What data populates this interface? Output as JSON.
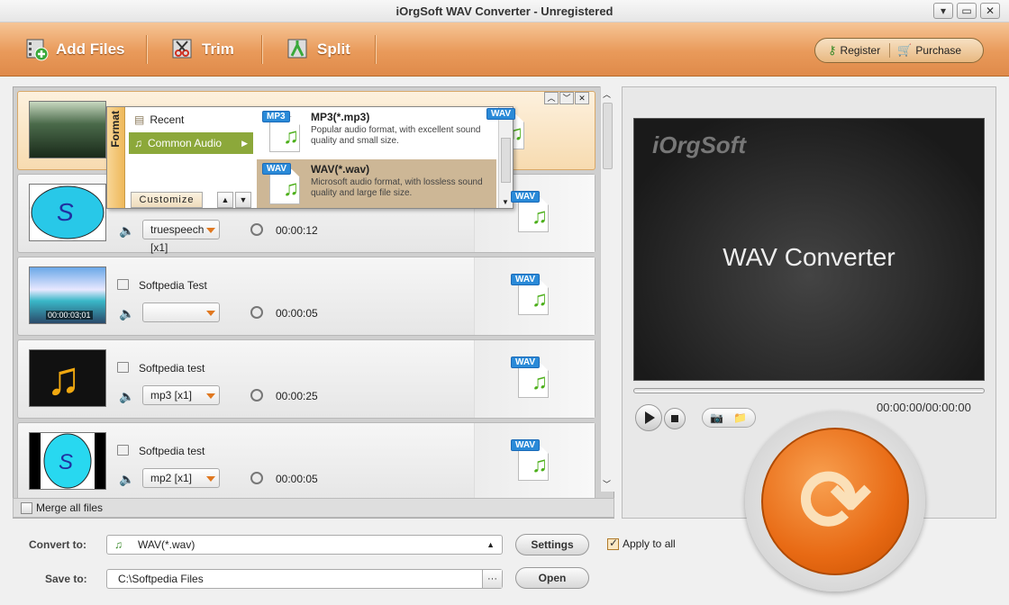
{
  "window": {
    "title": "iOrgSoft WAV Converter - Unregistered",
    "min": "▾",
    "restore": "▭",
    "close": "✕"
  },
  "toolbar": {
    "add_files": "Add Files",
    "trim": "Trim",
    "split": "Split",
    "register": "Register",
    "purchase": "Purchase"
  },
  "files": [
    {
      "name": "",
      "codec": "",
      "duration": "",
      "format_badge": "WAV",
      "thumb": "forest"
    },
    {
      "name": "",
      "codec": "truespeech [x1]",
      "duration": "00:00:12",
      "format_badge": "WAV",
      "thumb": "blue-ellipse"
    },
    {
      "name": "Softpedia Test",
      "codec": "",
      "duration": "00:00:05",
      "format_badge": "WAV",
      "thumb": "beach",
      "thumb_time": "00:00:03;01"
    },
    {
      "name": "Softpedia test",
      "codec": "mp3 [x1]",
      "duration": "00:00:25",
      "format_badge": "WAV",
      "thumb": "music-note"
    },
    {
      "name": "Softpedia test",
      "codec": "mp2 [x1]",
      "duration": "00:00:05",
      "format_badge": "WAV",
      "thumb": "cyan-ellipse"
    }
  ],
  "format_popup": {
    "side_label": "Format",
    "categories": [
      {
        "label": "Recent"
      },
      {
        "label": "Common Audio"
      }
    ],
    "customize": "Customize",
    "formats": [
      {
        "badge": "MP3",
        "title": "MP3(*.mp3)",
        "desc": "Popular audio format, with excellent sound quality and small size."
      },
      {
        "badge": "WAV",
        "title": "WAV(*.wav)",
        "desc": "Microsoft audio format, with lossless sound quality and large file size."
      }
    ]
  },
  "merge_label": "Merge all files",
  "preview": {
    "logo": "iOrgSoft",
    "title": "WAV Converter",
    "time": "00:00:00/00:00:00"
  },
  "bottom": {
    "convert_to_label": "Convert to:",
    "convert_to_value": "WAV(*.wav)",
    "settings": "Settings",
    "apply_all": "Apply to all",
    "save_to_label": "Save to:",
    "save_to_value": "C:\\Softpedia Files",
    "browse": "···",
    "open": "Open"
  },
  "colors": {
    "toolbar": "#e99a5a",
    "accent": "#e86a14",
    "selected_row": "#f7dbb0",
    "active_category": "#8ca83a"
  }
}
